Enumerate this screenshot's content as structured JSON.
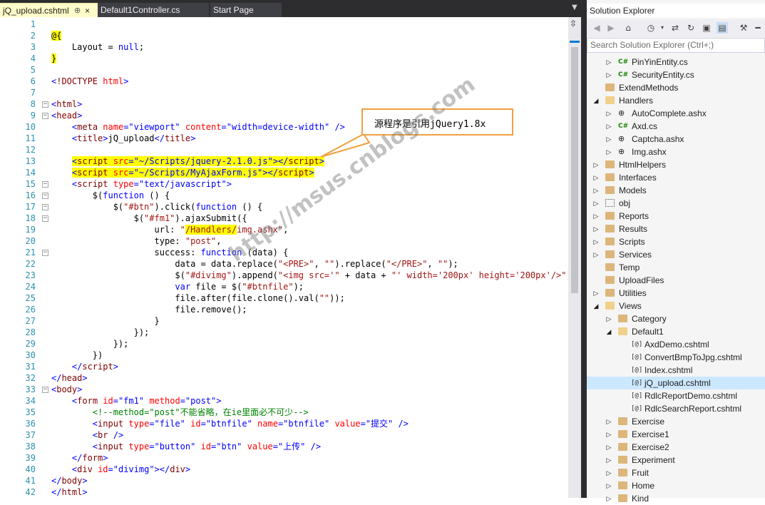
{
  "tabs": [
    {
      "label": "jQ_upload.cshtml",
      "active": true
    },
    {
      "label": "Default1Controller.cs",
      "active": false
    },
    {
      "label": "Start Page",
      "active": false
    }
  ],
  "tab_pin_glyph": "⊕",
  "tab_close_glyph": "×",
  "editor": {
    "lines": [
      {
        "n": "1",
        "html": ""
      },
      {
        "n": "2",
        "html": "<span class='k-razor'>@{</span>"
      },
      {
        "n": "3",
        "html": "    Layout = <span class='k-kw'>null</span>;"
      },
      {
        "n": "4",
        "html": "<span class='k-razor'>}</span>"
      },
      {
        "n": "5",
        "html": ""
      },
      {
        "n": "6",
        "html": "<span class='k-val'>&lt;</span><span class='k-tag'>!DOCTYPE</span> <span class='k-attr'>html</span><span class='k-val'>&gt;</span>"
      },
      {
        "n": "7",
        "html": ""
      },
      {
        "n": "8",
        "html": "<span class='k-val'>&lt;</span><span class='k-tag'>html</span><span class='k-val'>&gt;</span>"
      },
      {
        "n": "9",
        "html": "<span class='k-val'>&lt;</span><span class='k-tag'>head</span><span class='k-val'>&gt;</span>"
      },
      {
        "n": "10",
        "html": "    <span class='k-val'>&lt;</span><span class='k-tag'>meta</span> <span class='k-attr'>name</span><span class='k-val'>=\"viewport\"</span> <span class='k-attr'>content</span><span class='k-val'>=\"width=device-width\"</span> <span class='k-val'>/&gt;</span>"
      },
      {
        "n": "11",
        "html": "    <span class='k-val'>&lt;</span><span class='k-tag'>title</span><span class='k-val'>&gt;</span>jQ_upload<span class='k-val'>&lt;/</span><span class='k-tag'>title</span><span class='k-val'>&gt;</span>"
      },
      {
        "n": "12",
        "html": ""
      },
      {
        "n": "13",
        "html": "    <span class='hl'><span class='k-val'>&lt;</span><span class='k-tag'>script</span> <span class='k-attr'>src</span><span class='k-val'>=\"~/Scripts/jquery-2.1.0.js\"</span><span class='k-val'>&gt;&lt;/</span><span class='k-tag'>script</span><span class='k-val'>&gt;</span></span>"
      },
      {
        "n": "14",
        "html": "    <span class='hl'><span class='k-val'>&lt;</span><span class='k-tag'>script</span> <span class='k-attr'>src</span><span class='k-val'>=\"~/Scripts/MyAjaxForm.js\"</span><span class='k-val'>&gt;&lt;/</span><span class='k-tag'>script</span><span class='k-val'>&gt;</span></span>"
      },
      {
        "n": "15",
        "html": "    <span class='k-val'>&lt;</span><span class='k-tag'>script</span> <span class='k-attr'>type</span><span class='k-val'>=\"text/javascript\"</span><span class='k-val'>&gt;</span>"
      },
      {
        "n": "16",
        "html": "        $(<span class='k-kw'>function</span> () {"
      },
      {
        "n": "17",
        "html": "            $(<span class='k-str'>\"#btn\"</span>).click(<span class='k-kw'>function</span> () {"
      },
      {
        "n": "18",
        "html": "                $(<span class='k-str'>\"#fm1\"</span>).ajaxSubmit({"
      },
      {
        "n": "19",
        "html": "                    url: <span class='k-str'>\"<span class='hl'>/Handlers/</span>img.ashx\"</span>,"
      },
      {
        "n": "20",
        "html": "                    type: <span class='k-str'>\"post\"</span>,"
      },
      {
        "n": "21",
        "html": "                    success: <span class='k-kw'>function</span> (data) {"
      },
      {
        "n": "22",
        "html": "                        data = data.replace(<span class='k-str'>\"&lt;PRE&gt;\"</span>, <span class='k-str'>\"\"</span>).replace(<span class='k-str'>\"&lt;/PRE&gt;\"</span>, <span class='k-str'>\"\"</span>);"
      },
      {
        "n": "23",
        "html": "                        $(<span class='k-str'>\"#divimg\"</span>).append(<span class='k-str'>\"&lt;img src='\"</span> + data + <span class='k-str'>\"' width='200px' height='200px'/&gt;\"</span>);"
      },
      {
        "n": "24",
        "html": "                        <span class='k-kw'>var</span> file = $(<span class='k-str'>\"#btnfile\"</span>);"
      },
      {
        "n": "25",
        "html": "                        file.after(file.clone().val(<span class='k-str'>\"\"</span>));"
      },
      {
        "n": "26",
        "html": "                        file.remove();"
      },
      {
        "n": "27",
        "html": "                    }"
      },
      {
        "n": "28",
        "html": "                });"
      },
      {
        "n": "29",
        "html": "            });"
      },
      {
        "n": "30",
        "html": "        })"
      },
      {
        "n": "31",
        "html": "    <span class='k-val'>&lt;/</span><span class='k-tag'>script</span><span class='k-val'>&gt;</span>"
      },
      {
        "n": "32",
        "html": "<span class='k-val'>&lt;/</span><span class='k-tag'>head</span><span class='k-val'>&gt;</span>"
      },
      {
        "n": "33",
        "html": "<span class='k-val'>&lt;</span><span class='k-tag'>body</span><span class='k-val'>&gt;</span>"
      },
      {
        "n": "34",
        "html": "    <span class='k-val'>&lt;</span><span class='k-tag'>form</span> <span class='k-attr'>id</span><span class='k-val'>=\"fm1\"</span> <span class='k-attr'>method</span><span class='k-val'>=\"post\"</span><span class='k-val'>&gt;</span>"
      },
      {
        "n": "35",
        "html": "        <span class='k-com'>&lt;!--method=\"post\"不能省略，在ie里面必不可少--&gt;</span>"
      },
      {
        "n": "36",
        "html": "        <span class='k-val'>&lt;</span><span class='k-tag'>input</span> <span class='k-attr'>type</span><span class='k-val'>=\"file\"</span> <span class='k-attr'>id</span><span class='k-val'>=\"btnfile\"</span> <span class='k-attr'>name</span><span class='k-val'>=\"btnfile\"</span> <span class='k-attr'>value</span><span class='k-val'>=\"提交\"</span> <span class='k-val'>/&gt;</span>"
      },
      {
        "n": "37",
        "html": "        <span class='k-val'>&lt;</span><span class='k-tag'>br</span> <span class='k-val'>/&gt;</span>"
      },
      {
        "n": "38",
        "html": "        <span class='k-val'>&lt;</span><span class='k-tag'>input</span> <span class='k-attr'>type</span><span class='k-val'>=\"button\"</span> <span class='k-attr'>id</span><span class='k-val'>=\"btn\"</span> <span class='k-attr'>value</span><span class='k-val'>=\"上传\"</span> <span class='k-val'>/&gt;</span>"
      },
      {
        "n": "39",
        "html": "    <span class='k-val'>&lt;/</span><span class='k-tag'>form</span><span class='k-val'>&gt;</span>"
      },
      {
        "n": "40",
        "html": "    <span class='k-val'>&lt;</span><span class='k-tag'>div</span> <span class='k-attr'>id</span><span class='k-val'>=\"divimg\"</span><span class='k-val'>&gt;&lt;/</span><span class='k-tag'>div</span><span class='k-val'>&gt;</span>"
      },
      {
        "n": "41",
        "html": "<span class='k-val'>&lt;/</span><span class='k-tag'>body</span><span class='k-val'>&gt;</span>"
      },
      {
        "n": "42",
        "html": "<span class='k-val'>&lt;/</span><span class='k-tag'>html</span><span class='k-val'>&gt;</span>"
      }
    ],
    "fold_lines": [
      "8",
      "9",
      "15",
      "16",
      "17",
      "18",
      "21",
      "33"
    ]
  },
  "callout": {
    "text": "源程序是引用jQuery1.8x"
  },
  "watermark": {
    "text": "http://msus.cnblogs.com"
  },
  "solution_explorer": {
    "title": "Solution Explorer",
    "search_placeholder": "Search Solution Explorer (Ctrl+;)",
    "toolbar_icons": [
      "back-icon",
      "forward-icon",
      "home-icon",
      "history-icon",
      "dropdown-icon",
      "refresh-icon",
      "collapse-icon",
      "show-all-files-icon",
      "properties-icon",
      "pin-icon"
    ],
    "items": [
      {
        "label": "PinYinEntity.cs",
        "indent": 3,
        "arrow": "right",
        "icon": "cs"
      },
      {
        "label": "SecurityEntity.cs",
        "indent": 3,
        "arrow": "right",
        "icon": "cs"
      },
      {
        "label": "ExtendMethods",
        "indent": 2,
        "arrow": "",
        "icon": "folder"
      },
      {
        "label": "Handlers",
        "indent": 2,
        "arrow": "down",
        "icon": "folder-open"
      },
      {
        "label": "AutoComplete.ashx",
        "indent": 3,
        "arrow": "right",
        "icon": "ashx"
      },
      {
        "label": "Axd.cs",
        "indent": 3,
        "arrow": "right",
        "icon": "cs"
      },
      {
        "label": "Captcha.ashx",
        "indent": 3,
        "arrow": "right",
        "icon": "ashx"
      },
      {
        "label": "Img.ashx",
        "indent": 3,
        "arrow": "right",
        "icon": "ashx"
      },
      {
        "label": "HtmlHelpers",
        "indent": 2,
        "arrow": "right",
        "icon": "folder"
      },
      {
        "label": "Interfaces",
        "indent": 2,
        "arrow": "right",
        "icon": "folder"
      },
      {
        "label": "Models",
        "indent": 2,
        "arrow": "right",
        "icon": "folder"
      },
      {
        "label": "obj",
        "indent": 2,
        "arrow": "right",
        "icon": "obj"
      },
      {
        "label": "Reports",
        "indent": 2,
        "arrow": "right",
        "icon": "folder"
      },
      {
        "label": "Results",
        "indent": 2,
        "arrow": "right",
        "icon": "folder"
      },
      {
        "label": "Scripts",
        "indent": 2,
        "arrow": "right",
        "icon": "folder"
      },
      {
        "label": "Services",
        "indent": 2,
        "arrow": "right",
        "icon": "folder"
      },
      {
        "label": "Temp",
        "indent": 2,
        "arrow": "",
        "icon": "folder"
      },
      {
        "label": "UploadFiles",
        "indent": 2,
        "arrow": "",
        "icon": "folder"
      },
      {
        "label": "Utilities",
        "indent": 2,
        "arrow": "right",
        "icon": "folder"
      },
      {
        "label": "Views",
        "indent": 2,
        "arrow": "down",
        "icon": "folder-open"
      },
      {
        "label": "Category",
        "indent": 3,
        "arrow": "right",
        "icon": "folder"
      },
      {
        "label": "Default1",
        "indent": 3,
        "arrow": "down",
        "icon": "folder-open"
      },
      {
        "label": "AxdDemo.cshtml",
        "indent": 4,
        "arrow": "",
        "icon": "cshtml"
      },
      {
        "label": "ConvertBmpToJpg.cshtml",
        "indent": 4,
        "arrow": "",
        "icon": "cshtml"
      },
      {
        "label": "Index.cshtml",
        "indent": 4,
        "arrow": "",
        "icon": "cshtml"
      },
      {
        "label": "jQ_upload.cshtml",
        "indent": 4,
        "arrow": "",
        "icon": "cshtml",
        "selected": true
      },
      {
        "label": "RdlcReportDemo.cshtml",
        "indent": 4,
        "arrow": "",
        "icon": "cshtml"
      },
      {
        "label": "RdlcSearchReport.cshtml",
        "indent": 4,
        "arrow": "",
        "icon": "cshtml"
      },
      {
        "label": "Exercise",
        "indent": 3,
        "arrow": "right",
        "icon": "folder"
      },
      {
        "label": "Exercise1",
        "indent": 3,
        "arrow": "right",
        "icon": "folder"
      },
      {
        "label": "Exercise2",
        "indent": 3,
        "arrow": "right",
        "icon": "folder"
      },
      {
        "label": "Experiment",
        "indent": 3,
        "arrow": "right",
        "icon": "folder"
      },
      {
        "label": "Fruit",
        "indent": 3,
        "arrow": "right",
        "icon": "folder"
      },
      {
        "label": "Home",
        "indent": 3,
        "arrow": "right",
        "icon": "folder"
      },
      {
        "label": "Kind",
        "indent": 3,
        "arrow": "right",
        "icon": "folder"
      }
    ]
  }
}
